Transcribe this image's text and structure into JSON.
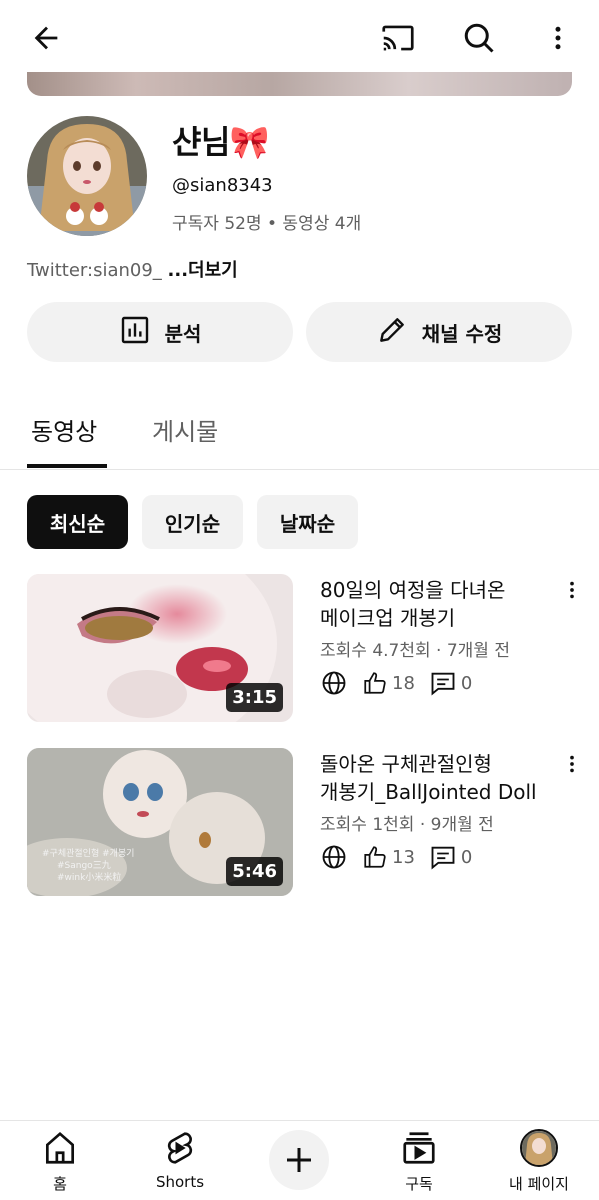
{
  "header": {
    "back": "arrow-left-icon",
    "cast": "cast-icon",
    "search": "search-icon",
    "more": "more-vert-icon"
  },
  "channel": {
    "name": "샨님🎀",
    "handle": "@sian8343",
    "stats": "구독자 52명 • 동영상 4개",
    "description": "Twitter:sian09_",
    "more_label": "...더보기"
  },
  "buttons": {
    "analytics": "분석",
    "edit_channel": "채널 수정"
  },
  "tabs": [
    {
      "label": "동영상",
      "active": true
    },
    {
      "label": "게시물",
      "active": false
    }
  ],
  "chips": [
    {
      "label": "최신순",
      "active": true
    },
    {
      "label": "인기순",
      "active": false
    },
    {
      "label": "날짜순",
      "active": false
    }
  ],
  "videos": [
    {
      "title_line1": "80일의 여정을 다녀온",
      "title_line2": "메이크업 개봉기",
      "meta": "조회수 4.7천회 · 7개월 전",
      "duration": "3:15",
      "likes": "18",
      "comments": "0",
      "visibility_icon": "globe-icon"
    },
    {
      "title_line1": "돌아온 구체관절인형",
      "title_line2": "개봉기_BallJointed Doll",
      "meta": "조회수 1천회 · 9개월 전",
      "duration": "5:46",
      "likes": "13",
      "comments": "0",
      "visibility_icon": "globe-icon",
      "thumbnail_text": [
        "#구체관절인형 #개봉기",
        "#Sango三九",
        "#wink小米米粒"
      ]
    }
  ],
  "bottom_nav": [
    {
      "label": "홈",
      "icon": "home-icon"
    },
    {
      "label": "Shorts",
      "icon": "shorts-icon"
    },
    {
      "label": "",
      "icon": "add-icon"
    },
    {
      "label": "구독",
      "icon": "subscriptions-icon"
    },
    {
      "label": "내 페이지",
      "icon": "avatar"
    }
  ],
  "colors": {
    "text": "#0f0f0f",
    "secondary": "#606060",
    "chip_bg": "#f2f2f2",
    "active_chip": "#0f0f0f",
    "ribbon": "#ff4f9a"
  }
}
